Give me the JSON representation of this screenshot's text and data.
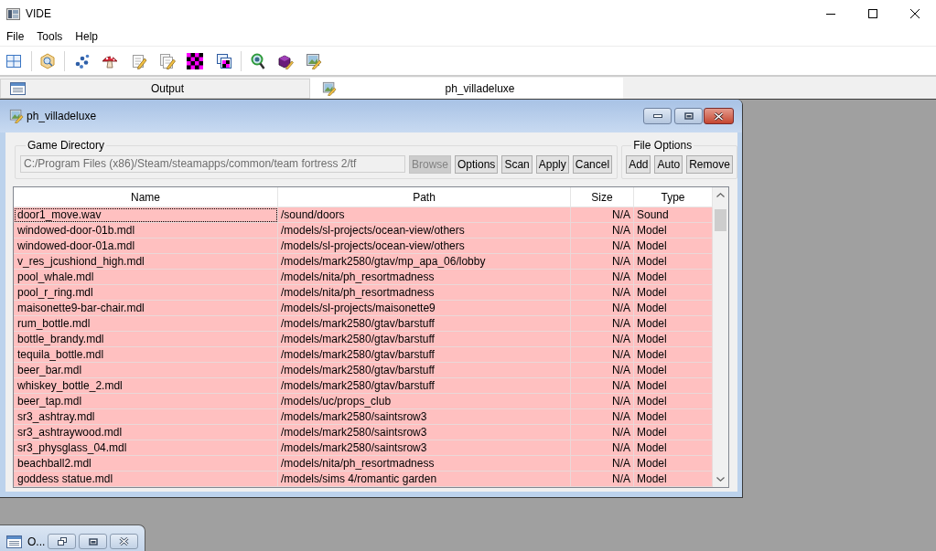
{
  "window": {
    "title": "VIDE"
  },
  "menu": [
    "File",
    "Tools",
    "Help"
  ],
  "tabs": [
    {
      "label": "Output",
      "kind": "console",
      "selected": false
    },
    {
      "label": "ph_villadeluxe",
      "kind": "document",
      "selected": true
    }
  ],
  "document_window": {
    "title": "ph_villadeluxe",
    "game_directory": {
      "label": "Game Directory",
      "path": "C:/Program Files (x86)/Steam/steamapps/common/team fortress 2/tf",
      "disabled": true,
      "buttons": [
        {
          "label": "Browse",
          "disabled": true
        },
        {
          "label": "Options",
          "disabled": false
        },
        {
          "label": "Scan",
          "disabled": false
        },
        {
          "label": "Apply",
          "disabled": false
        },
        {
          "label": "Cancel",
          "disabled": false
        }
      ]
    },
    "file_options": {
      "label": "File Options",
      "buttons": [
        {
          "label": "Add",
          "disabled": false
        },
        {
          "label": "Auto",
          "disabled": false
        },
        {
          "label": "Remove",
          "disabled": false
        }
      ]
    },
    "table": {
      "columns": [
        "Name",
        "Path",
        "Size",
        "Type"
      ],
      "rows": [
        {
          "name": "door1_move.wav",
          "path": "/sound/doors",
          "size": "N/A",
          "type": "Sound",
          "focused": true
        },
        {
          "name": "windowed-door-01b.mdl",
          "path": "/models/sl-projects/ocean-view/others",
          "size": "N/A",
          "type": "Model",
          "focused": false
        },
        {
          "name": "windowed-door-01a.mdl",
          "path": "/models/sl-projects/ocean-view/others",
          "size": "N/A",
          "type": "Model",
          "focused": false
        },
        {
          "name": "v_res_jcushiond_high.mdl",
          "path": "/models/mark2580/gtav/mp_apa_06/lobby",
          "size": "N/A",
          "type": "Model",
          "focused": false
        },
        {
          "name": "pool_whale.mdl",
          "path": "/models/nita/ph_resortmadness",
          "size": "N/A",
          "type": "Model",
          "focused": false
        },
        {
          "name": "pool_r_ring.mdl",
          "path": "/models/nita/ph_resortmadness",
          "size": "N/A",
          "type": "Model",
          "focused": false
        },
        {
          "name": "maisonette9-bar-chair.mdl",
          "path": "/models/sl-projects/maisonette9",
          "size": "N/A",
          "type": "Model",
          "focused": false
        },
        {
          "name": "rum_bottle.mdl",
          "path": "/models/mark2580/gtav/barstuff",
          "size": "N/A",
          "type": "Model",
          "focused": false
        },
        {
          "name": "bottle_brandy.mdl",
          "path": "/models/mark2580/gtav/barstuff",
          "size": "N/A",
          "type": "Model",
          "focused": false
        },
        {
          "name": "tequila_bottle.mdl",
          "path": "/models/mark2580/gtav/barstuff",
          "size": "N/A",
          "type": "Model",
          "focused": false
        },
        {
          "name": "beer_bar.mdl",
          "path": "/models/mark2580/gtav/barstuff",
          "size": "N/A",
          "type": "Model",
          "focused": false
        },
        {
          "name": "whiskey_bottle_2.mdl",
          "path": "/models/mark2580/gtav/barstuff",
          "size": "N/A",
          "type": "Model",
          "focused": false
        },
        {
          "name": "beer_tap.mdl",
          "path": "/models/uc/props_club",
          "size": "N/A",
          "type": "Model",
          "focused": false
        },
        {
          "name": "sr3_ashtray.mdl",
          "path": "/models/mark2580/saintsrow3",
          "size": "N/A",
          "type": "Model",
          "focused": false
        },
        {
          "name": "sr3_ashtraywood.mdl",
          "path": "/models/mark2580/saintsrow3",
          "size": "N/A",
          "type": "Model",
          "focused": false
        },
        {
          "name": "sr3_physglass_04.mdl",
          "path": "/models/mark2580/saintsrow3",
          "size": "N/A",
          "type": "Model",
          "focused": false
        },
        {
          "name": "beachball2.mdl",
          "path": "/models/nita/ph_resortmadness",
          "size": "N/A",
          "type": "Model",
          "focused": false
        },
        {
          "name": "goddess statue.mdl",
          "path": "/models/sims 4/romantic garden",
          "size": "N/A",
          "type": "Model",
          "focused": false
        }
      ]
    }
  },
  "minimized_window": {
    "title": "O..."
  }
}
